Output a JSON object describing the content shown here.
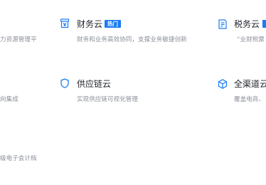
{
  "left_column": {
    "row1_desc": "力资源管理平",
    "row2_desc": "向集成",
    "row3_desc": "级电子会计档"
  },
  "middle_column": {
    "cards": [
      {
        "icon": "finance-cloud-icon",
        "title": "财务云",
        "badge": "热门",
        "desc": "财务和业务高效协同，支撑业务敏捷创新"
      },
      {
        "icon": "supply-chain-shield-icon",
        "title": "供应链云",
        "desc": "实现供应链可视化管理"
      }
    ]
  },
  "right_column": {
    "cards": [
      {
        "icon": "tax-cloud-icon",
        "title": "税务云",
        "desc": "“业财税票"
      },
      {
        "icon": "omnichannel-cube-icon",
        "title": "全渠道云",
        "desc": "覆盖电商、"
      }
    ]
  },
  "colors": {
    "accent": "#1a7cf5",
    "title": "#1f2329",
    "desc": "#8a8f99"
  }
}
